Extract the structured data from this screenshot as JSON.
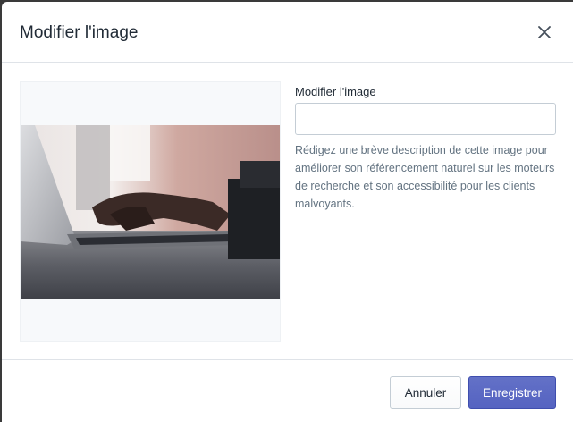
{
  "modal": {
    "title": "Modifier l'image",
    "close_icon": "close-icon"
  },
  "form": {
    "label": "Modifier l'image",
    "input_value": "",
    "input_placeholder": "",
    "help_text": "Rédigez une brève description de cette image pour améliorer son référencement naturel sur les moteurs de recherche et son accessibilité pour les clients malvoyants."
  },
  "footer": {
    "cancel_label": "Annuler",
    "save_label": "Enregistrer"
  },
  "colors": {
    "primary": "#5c6ac4",
    "text": "#212b36",
    "subdued_text": "#637381",
    "border": "#c4cdd5"
  }
}
